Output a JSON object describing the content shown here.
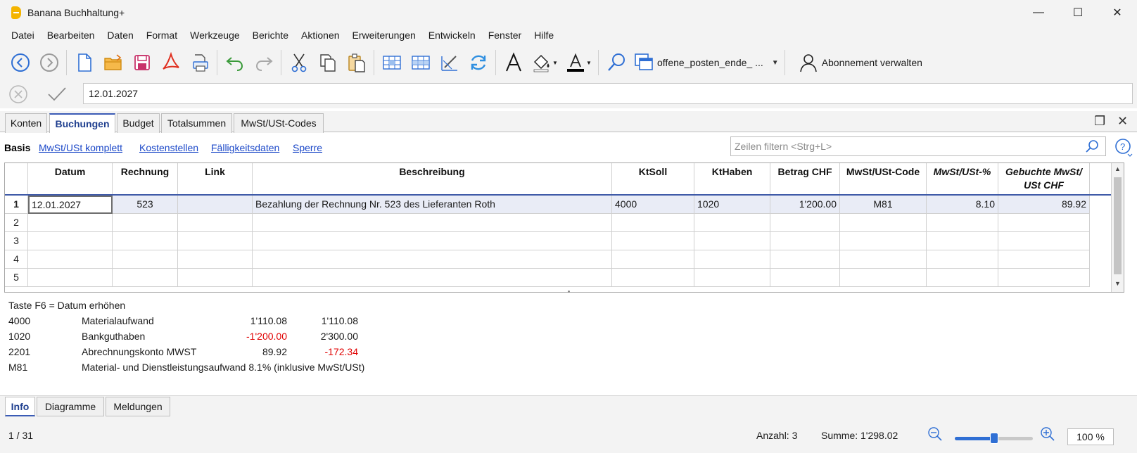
{
  "window": {
    "title": "Banana Buchhaltung+",
    "buttons": {
      "minimize": "—",
      "maximize": "☐",
      "close": "✕"
    }
  },
  "menu": [
    "Datei",
    "Bearbeiten",
    "Daten",
    "Format",
    "Werkzeuge",
    "Berichte",
    "Aktionen",
    "Erweiterungen",
    "Entwickeln",
    "Fenster",
    "Hilfe"
  ],
  "toolbar": {
    "document": "offene_posten_ende_ ...",
    "subscription": "Abonnement verwalten",
    "icons": [
      "back-icon",
      "forward-icon",
      "new-file-icon",
      "open-folder-icon",
      "save-icon",
      "pdf-icon",
      "print-icon",
      "undo-icon",
      "redo-icon",
      "cut-icon",
      "copy-icon",
      "paste-icon",
      "add-rows-icon",
      "delete-rows-icon",
      "edit-icon",
      "recalculate-icon",
      "font-icon",
      "fill-color-icon",
      "text-color-icon",
      "search-icon",
      "window-icon",
      "user-icon"
    ]
  },
  "editbar": {
    "value": "12.01.2027"
  },
  "tabs": [
    "Konten",
    "Buchungen",
    "Budget",
    "Totalsummen",
    "MwSt/USt-Codes"
  ],
  "active_tab": "Buchungen",
  "views": [
    "Basis",
    "MwSt/USt komplett",
    "Kostenstellen",
    "Fälligkeitsdaten",
    "Sperre"
  ],
  "filter": {
    "placeholder": "Zeilen filtern <Strg+L>"
  },
  "grid": {
    "columns": [
      "Datum",
      "Rechnung",
      "Link",
      "Beschreibung",
      "KtSoll",
      "KtHaben",
      "Betrag CHF",
      "MwSt/USt-Code",
      "MwSt/USt-%",
      "Gebuchte MwSt/ USt CHF"
    ],
    "row_numbers": [
      "1",
      "2",
      "3",
      "4",
      "5"
    ],
    "rows": [
      [
        "12.01.2027",
        "523",
        "",
        "Bezahlung der Rechnung Nr. 523 des Lieferanten Roth",
        "4000",
        "1020",
        "1'200.00",
        "M81",
        "8.10",
        "89.92"
      ]
    ]
  },
  "info": {
    "hint": "Taste F6 = Datum erhöhen",
    "accounts": [
      {
        "code": "4000",
        "name": "Materialaufwand",
        "amount": "1'110.08",
        "balance": "1'110.08"
      },
      {
        "code": "1020",
        "name": "Bankguthaben",
        "amount": "-1'200.00",
        "balance": "2'300.00"
      },
      {
        "code": "2201",
        "name": "Abrechnungskonto MWST",
        "amount": "89.92",
        "balance": "-172.34"
      }
    ],
    "vat": {
      "code": "M81",
      "desc": "Material- und Dienstleistungsaufwand 8.1% (inklusive MwSt/USt)"
    }
  },
  "bottom_tabs": [
    "Info",
    "Diagramme",
    "Meldungen"
  ],
  "status": {
    "position": "1 / 31",
    "count": "Anzahl: 3",
    "sum": "Summe: 1'298.02",
    "zoom": "100 %",
    "zoom_level": 0.5
  },
  "colors": {
    "accent": "#1f3f8f",
    "link": "#1a47c8",
    "negative": "#e00000",
    "selected_row": "#e9ecf6"
  }
}
